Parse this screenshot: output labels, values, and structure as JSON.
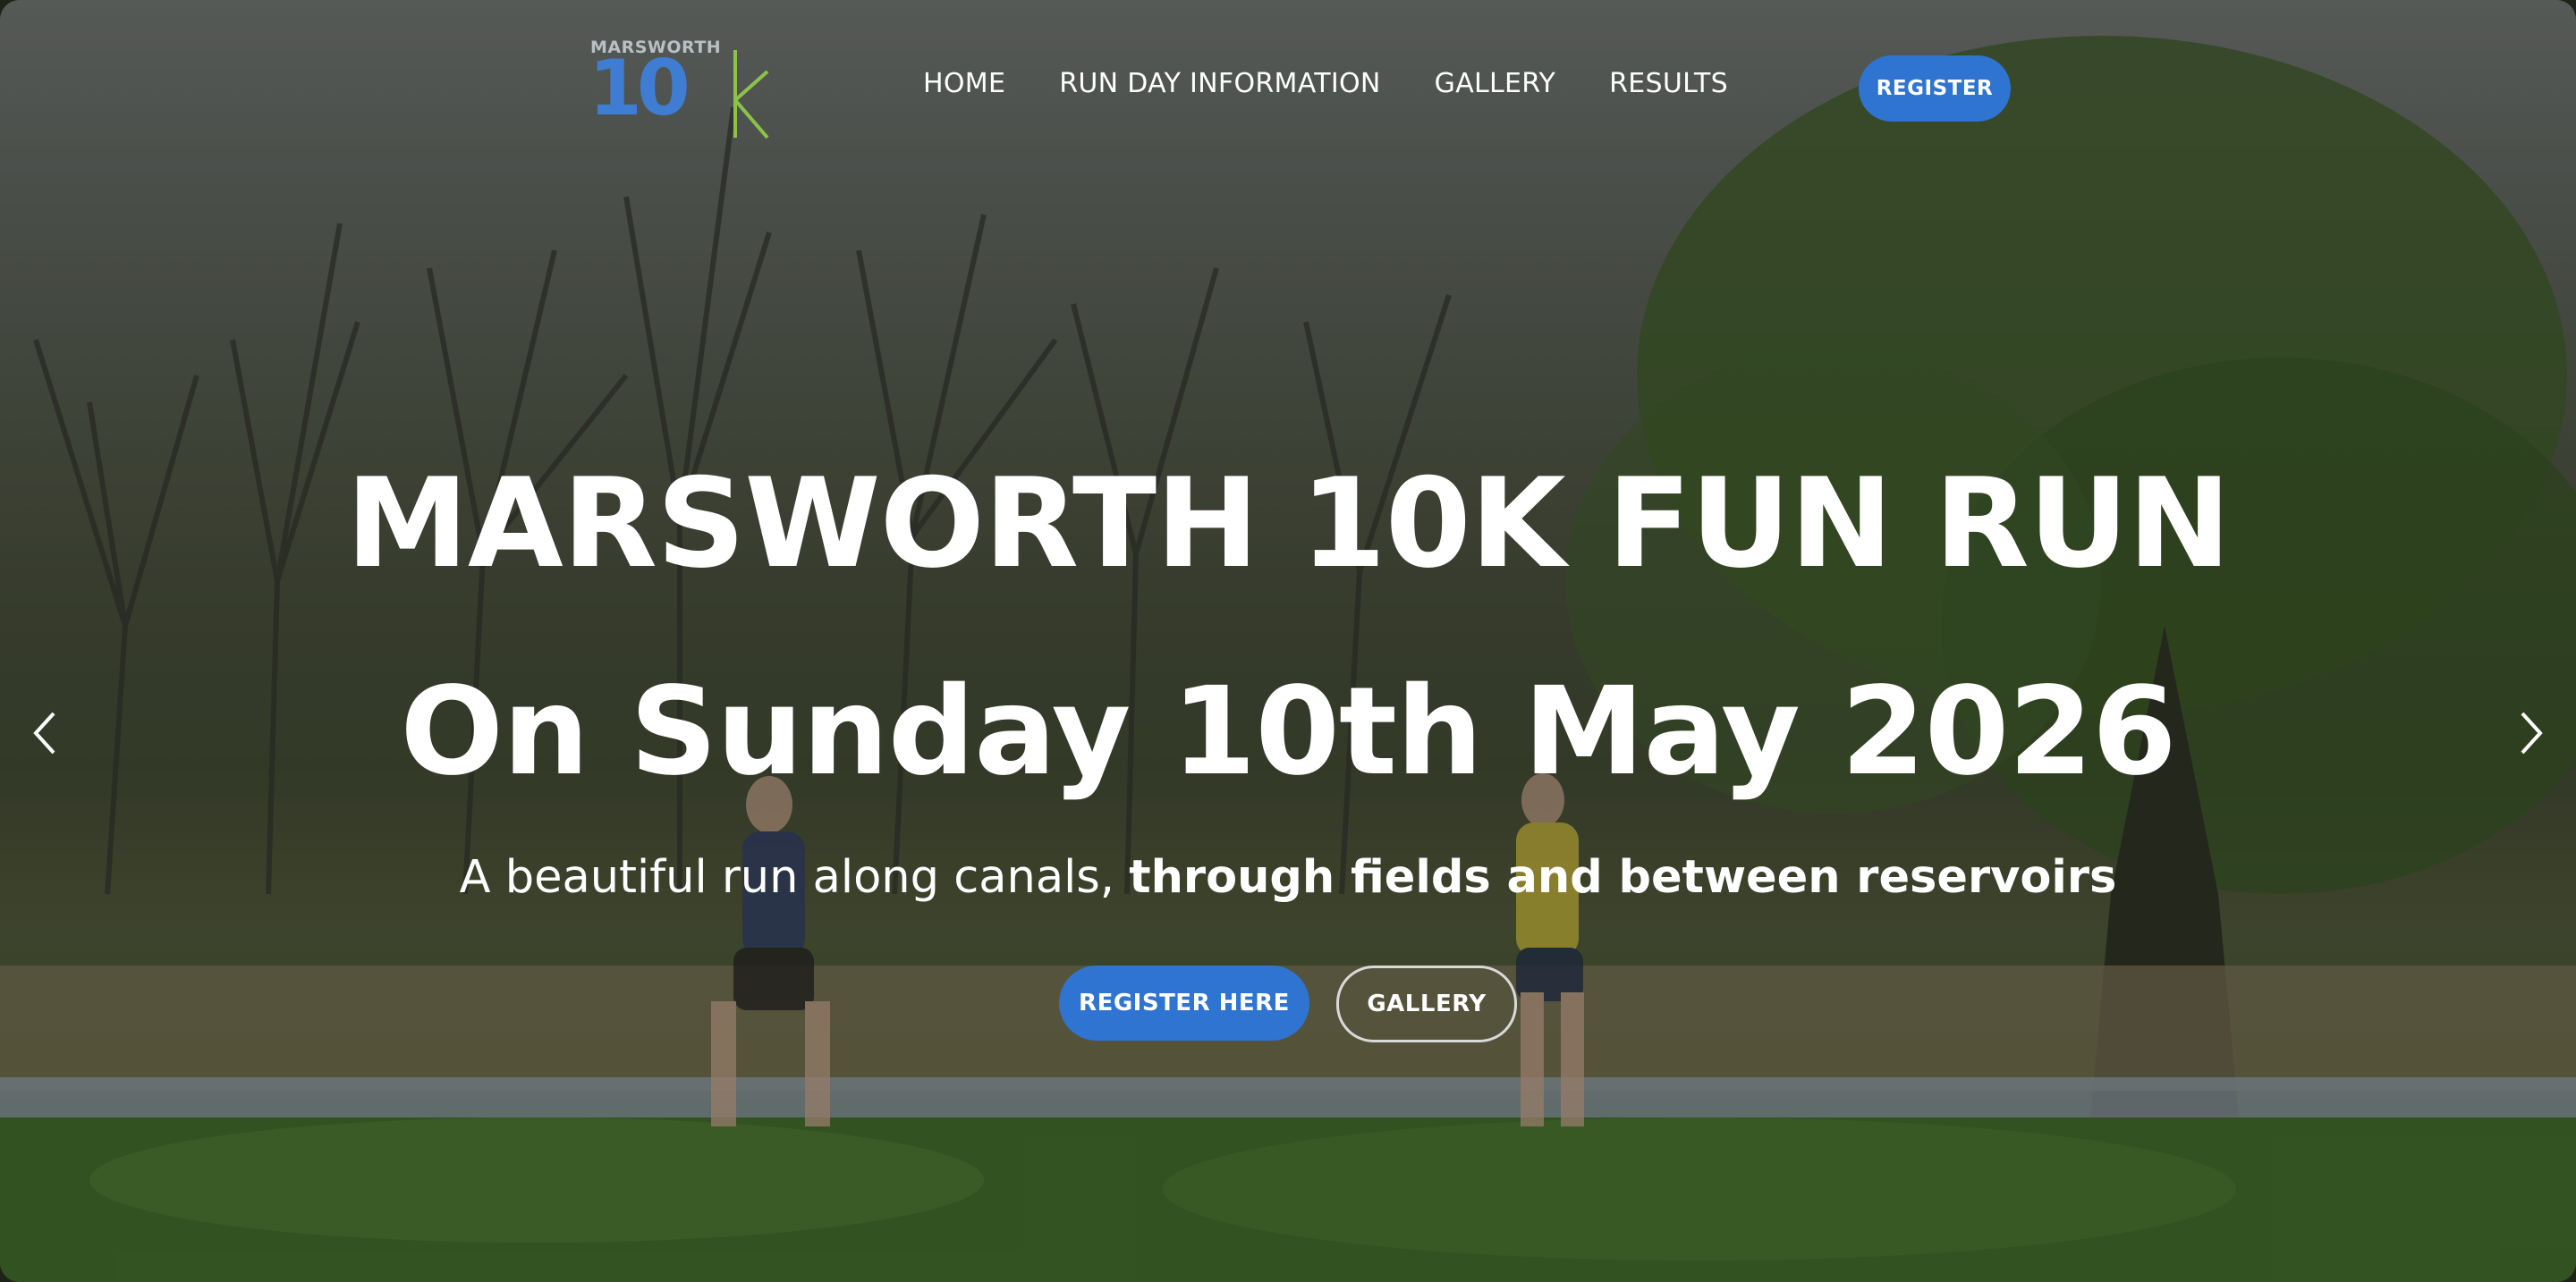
{
  "logo": {
    "word": "MARSWORTH",
    "number": "10",
    "letter": "k"
  },
  "nav": {
    "items": [
      "HOME",
      "RUN DAY INFORMATION",
      "GALLERY",
      "RESULTS"
    ],
    "register_label": "REGISTER"
  },
  "hero": {
    "title": "MARSWORTH 10K FUN RUN",
    "date": "On Sunday 10th May 2026",
    "subtitle_light": "A beautiful run along canals, ",
    "subtitle_strong": "through fields and between reservoirs",
    "primary_cta": "REGISTER HERE",
    "secondary_cta": "GALLERY"
  },
  "carousel": {
    "prev_icon": "chevron-left-icon",
    "next_icon": "chevron-right-icon"
  },
  "colors": {
    "accent": "#2f74d0",
    "logo_blue": "#3f7dd3",
    "logo_green": "#8bc34a",
    "text": "#ffffff"
  }
}
